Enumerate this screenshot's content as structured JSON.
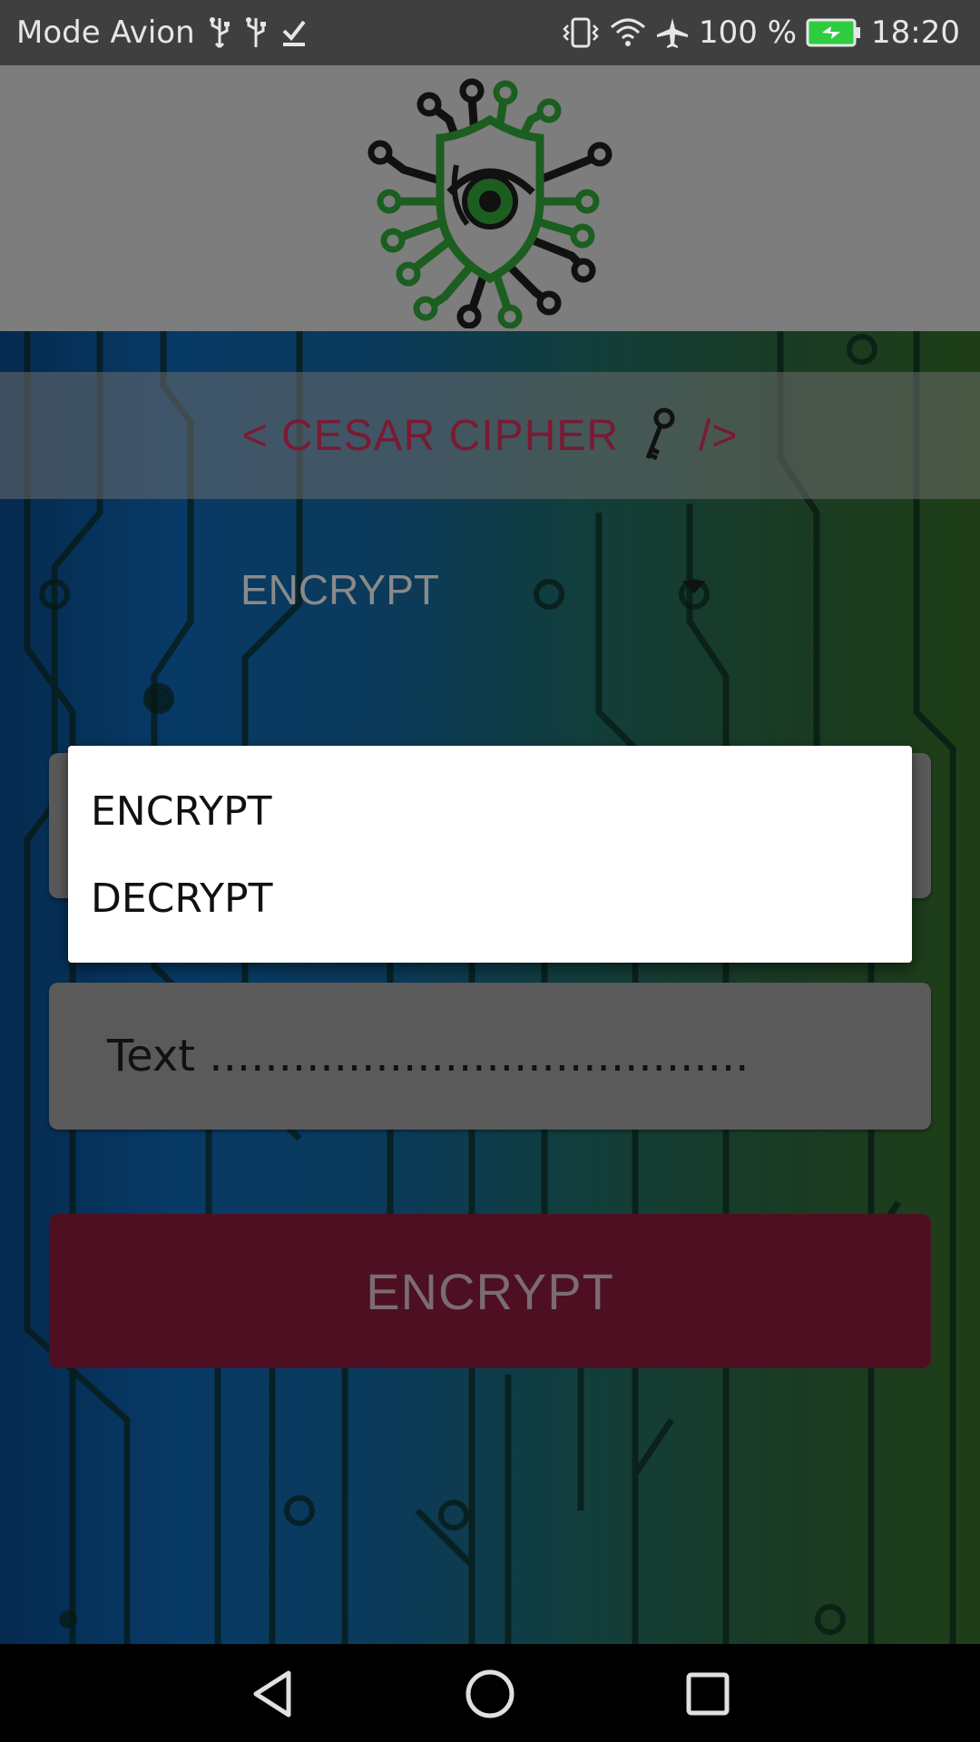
{
  "status_bar": {
    "carrier": "Mode Avion",
    "battery": "100 %",
    "time": "18:20",
    "icons_left": [
      "usb-icon",
      "usb-icon",
      "download-done-icon"
    ],
    "icons_right": [
      "vibrate-icon",
      "wifi-icon",
      "airplane-icon",
      "battery-charging-icon"
    ]
  },
  "header": {
    "logo": "cyber-eye-shield-logo"
  },
  "title": {
    "prefix": "< CESAR CIPHER",
    "suffix": "/>",
    "icon": "key-icon"
  },
  "mode_spinner": {
    "selected": "ENCRYPT"
  },
  "text_field": {
    "placeholder": "Text ......................................."
  },
  "action_button": {
    "label": "ENCRYPT"
  },
  "dropdown": {
    "options": [
      "ENCRYPT",
      "DECRYPT"
    ]
  },
  "nav_bar": {
    "buttons": [
      "back-icon",
      "home-icon",
      "recents-icon"
    ]
  },
  "colors": {
    "title_text": "#7a1a33",
    "button_bg": "#4e0f22",
    "status_bar_bg": "#3f3f3f",
    "logo_green": "#1b5e20"
  }
}
